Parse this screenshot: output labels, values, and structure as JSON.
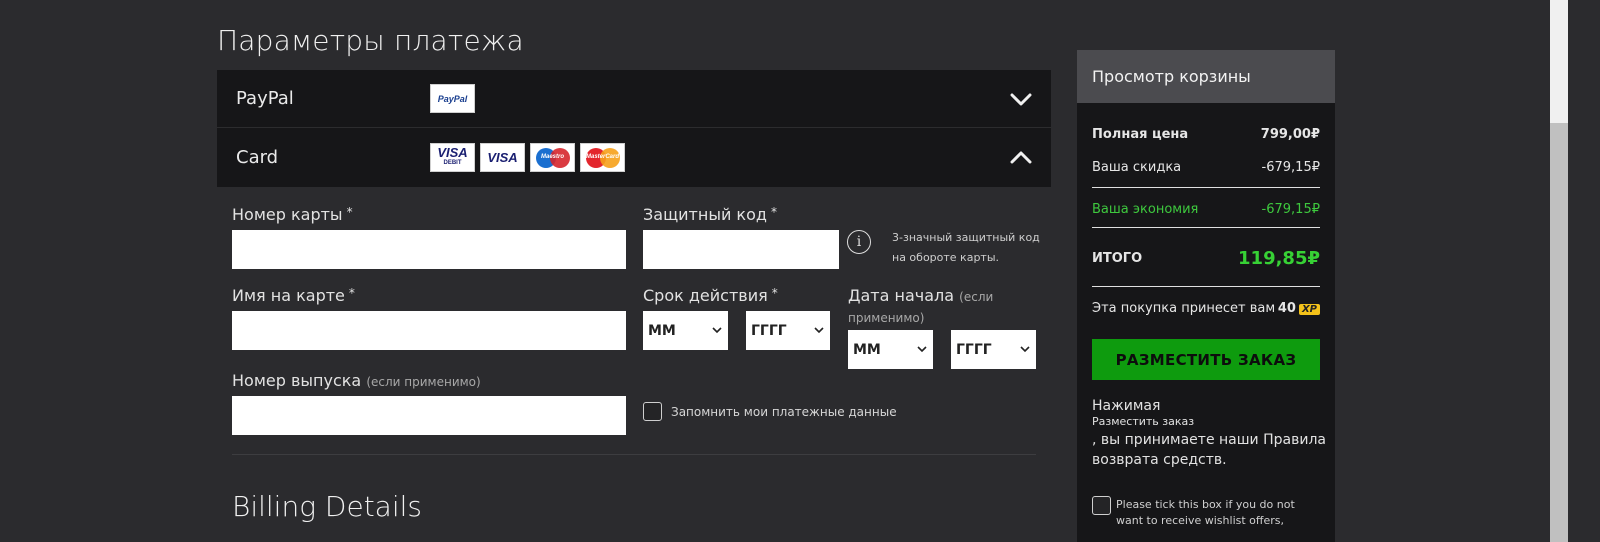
{
  "page": {
    "title": "Параметры платежа",
    "billing_title": "Billing Details"
  },
  "payment_methods": [
    {
      "label": "PayPal",
      "expanded": false,
      "logos": [
        "PayPal"
      ]
    },
    {
      "label": "Card",
      "expanded": true,
      "logos": [
        "VISA DEBIT",
        "VISA",
        "Maestro",
        "MasterCard"
      ]
    }
  ],
  "form": {
    "card_number_label": "Номер карты",
    "security_code_label": "Защитный код",
    "security_hint": "3-значный защитный код на обороте карты.",
    "name_on_card_label": "Имя на карте",
    "expiry_label": "Срок действия",
    "start_date_label": "Дата начала",
    "start_date_hint": "(если применимо)",
    "issue_number_label": "Номер выпуска",
    "issue_number_hint": "(если применимо)",
    "required_mark": "*",
    "month_placeholder": "ММ",
    "year_placeholder": "ГГГГ",
    "remember_label": "Запомнить мои платежные данные"
  },
  "cart": {
    "header": "Просмотр корзины",
    "full_price_label": "Полная цена",
    "full_price_value": "799,00₽",
    "discount_label": "Ваша скидка",
    "discount_value": "-679,15₽",
    "savings_label": "Ваша экономия",
    "savings_value": "-679,15₽",
    "total_label": "ИТОГО",
    "total_value": "119,85₽",
    "xp_label": "Эта покупка принесет вам",
    "xp_value": "40",
    "xp_badge": "XP",
    "place_order_label": "РАЗМЕСТИТЬ ЗАКАЗ",
    "terms_1": "Нажимая",
    "terms_2": "Разместить заказ",
    "terms_3": ", вы принимаете наши Правила возврата средств.",
    "wishlist_label": "Please tick this box if you do not want to receive wishlist offers,"
  },
  "colors": {
    "accent_green": "#0e9b0e",
    "price_green": "#37d135",
    "panel": "#161618",
    "background": "#2b2b2e"
  }
}
